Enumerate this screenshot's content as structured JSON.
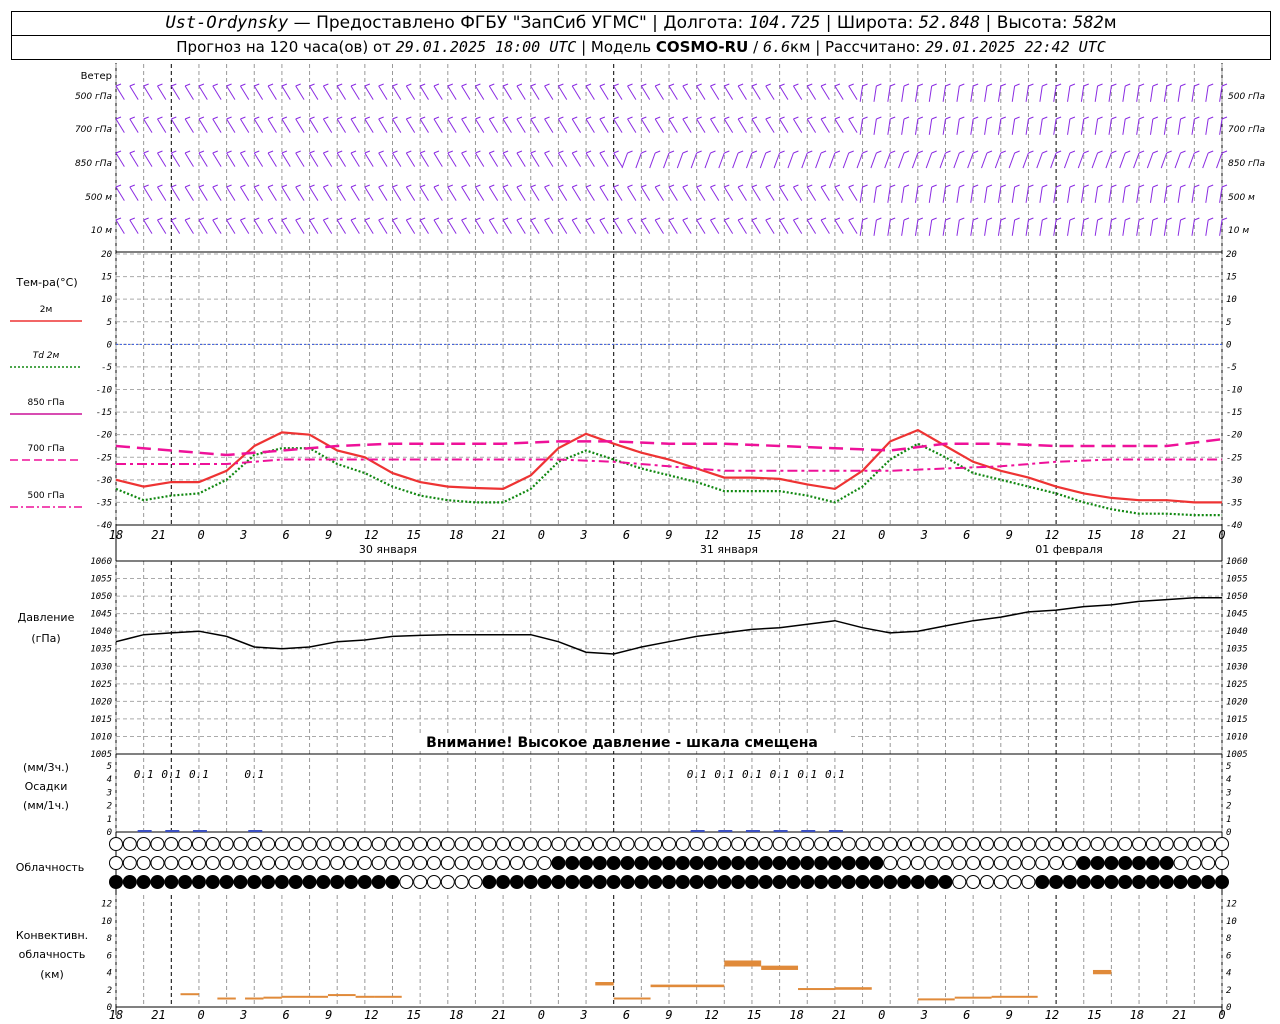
{
  "header": {
    "station": "Ust-Ordynsky",
    "provided": "— Предоставлено ФГБУ \"ЗапСиб УГМС\"",
    "lon_label": "Долгота:",
    "lon": "104.725",
    "lat_label": "Широта:",
    "lat": "52.848",
    "alt_label": "Высота:",
    "alt": "582",
    "alt_unit": "м",
    "forecast_label": "Прогноз на 120 часа(ов) от",
    "forecast_start": "29.01.2025 18:00 UTC",
    "model_label": "Модель",
    "model": "COSMO-RU",
    "model_res": "6.6",
    "model_res_unit": "км",
    "calc_label": "Рассчитано:",
    "calc_time": "29.01.2025 22:42 UTC"
  },
  "wind_panel": {
    "row_labels": [
      "500 гПа",
      "700 гПа",
      "850 гПа",
      "500 м",
      "10  м"
    ],
    "title": "Ветер",
    "color": "#8a2be2"
  },
  "temp_panel": {
    "title": "Тем-ра(°С)",
    "legend": [
      {
        "label": "2м",
        "color": "#ee3333",
        "style": "solid"
      },
      {
        "label": "Td  2м",
        "color": "#118811",
        "style": "dotted"
      },
      {
        "label": "850 гПа",
        "color": "#cc1199",
        "style": "solid"
      },
      {
        "label": "700 гПа",
        "color": "#ee1199",
        "style": "dash"
      },
      {
        "label": "500 гПа",
        "color": "#ee1199",
        "style": "dashdot"
      }
    ],
    "ticks": [
      20,
      15,
      10,
      5,
      0,
      -5,
      -10,
      -15,
      -20,
      -25,
      -30,
      -35,
      -40
    ]
  },
  "time_axis": {
    "hour_labels": [
      "18",
      "21",
      "0",
      "3",
      "6",
      "9",
      "12",
      "15",
      "18",
      "21",
      "0",
      "3",
      "6",
      "9",
      "12",
      "15",
      "18",
      "21",
      "0",
      "3",
      "6",
      "9",
      "12",
      "15",
      "18",
      "21",
      "0"
    ],
    "date_labels": [
      "30 января",
      "31 января",
      "01 февраля"
    ]
  },
  "pressure_panel": {
    "title": "Давление",
    "unit": "(гПа)",
    "ticks": [
      1060,
      1055,
      1050,
      1045,
      1040,
      1035,
      1030,
      1025,
      1020,
      1015,
      1010,
      1005
    ],
    "warning": "Внимание! Высокое давление - шкала смещена"
  },
  "precip_panel": {
    "unit_top": "(мм/3ч.)",
    "title": "Осадки",
    "unit_bottom": "(мм/1ч.)",
    "ticks": [
      5,
      4,
      3,
      2,
      1,
      0
    ],
    "labels": [
      {
        "h": 3,
        "text": "0.1"
      },
      {
        "h": 6,
        "text": "0.1"
      },
      {
        "h": 9,
        "text": "0.1"
      },
      {
        "h": 15,
        "text": "0.1"
      },
      {
        "h": 63,
        "text": "0.1"
      },
      {
        "h": 66,
        "text": "0.1"
      },
      {
        "h": 69,
        "text": "0.1"
      },
      {
        "h": 72,
        "text": "0.1"
      },
      {
        "h": 75,
        "text": "0.1"
      },
      {
        "h": 78,
        "text": "0.1"
      }
    ]
  },
  "cloud_panel": {
    "title": "Облачность"
  },
  "conv_panel": {
    "title_line1": "Конвективн.",
    "title_line2": "облачность",
    "unit": "(км)",
    "ticks": [
      12,
      10,
      8,
      6,
      4,
      2,
      0
    ],
    "color": "#e08a3a"
  },
  "chart_data": [
    {
      "type": "line",
      "title": "Тем-ра(°С)",
      "x_unit": "hours since 29.01.2025 18:00 UTC",
      "ylim": [
        -40,
        20
      ],
      "series": [
        {
          "name": "2м",
          "x": [
            0,
            3,
            6,
            9,
            12,
            15,
            18,
            21,
            24,
            27,
            30,
            33,
            36,
            39,
            42,
            45,
            48,
            51,
            54,
            57,
            60,
            63,
            66,
            69,
            72,
            75,
            78,
            81,
            84,
            87,
            90,
            93,
            96,
            99,
            102,
            105,
            108,
            111,
            114,
            117,
            120
          ],
          "values": [
            -30,
            -31.5,
            -30.5,
            -30.5,
            -28,
            -22.5,
            -19.5,
            -20,
            -23.5,
            -25,
            -28.5,
            -30.5,
            -31.5,
            -31.8,
            -32,
            -29,
            -23,
            -19.8,
            -22,
            -24,
            -25.5,
            -27.5,
            -29.5,
            -29.5,
            -29.8,
            -31,
            -32,
            -28,
            -21.5,
            -19,
            -22.5,
            -26,
            -28,
            -29.5,
            -31.5,
            -33,
            -34,
            -34.5,
            -34.5,
            -35,
            -35
          ]
        },
        {
          "name": "Td  2м",
          "x": [
            0,
            3,
            6,
            9,
            12,
            15,
            18,
            21,
            24,
            27,
            30,
            33,
            36,
            39,
            42,
            45,
            48,
            51,
            54,
            57,
            60,
            63,
            66,
            69,
            72,
            75,
            78,
            81,
            84,
            87,
            90,
            93,
            96,
            99,
            102,
            105,
            108,
            111,
            114,
            117,
            120
          ],
          "values": [
            -32,
            -34.5,
            -33.5,
            -33,
            -30,
            -24.5,
            -23,
            -23,
            -26.5,
            -28.5,
            -31.5,
            -33.5,
            -34.5,
            -35,
            -35,
            -32,
            -26,
            -23.5,
            -25.5,
            -27.5,
            -29,
            -30.5,
            -32.5,
            -32.5,
            -32.5,
            -33.5,
            -35,
            -31.5,
            -25.5,
            -22,
            -25,
            -28.5,
            -30,
            -31.5,
            -33,
            -35,
            -36.5,
            -37.5,
            -37.5,
            -37.8,
            -37.8
          ]
        },
        {
          "name": "700 гПа",
          "x": [
            0,
            6,
            12,
            18,
            24,
            30,
            36,
            42,
            48,
            54,
            60,
            66,
            72,
            78,
            84,
            90,
            96,
            102,
            108,
            114,
            120
          ],
          "values": [
            -22.5,
            -23.5,
            -24.5,
            -23.5,
            -22.5,
            -22,
            -22,
            -22,
            -21.5,
            -21.5,
            -22,
            -22,
            -22.5,
            -23,
            -23.5,
            -22,
            -22,
            -22.5,
            -22.5,
            -22.5,
            -21
          ]
        },
        {
          "name": "500 гПа",
          "x": [
            0,
            6,
            12,
            18,
            24,
            30,
            36,
            42,
            48,
            54,
            60,
            66,
            72,
            78,
            84,
            90,
            96,
            102,
            108,
            114,
            120
          ],
          "values": [
            -26.5,
            -26.5,
            -26.5,
            -25.5,
            -25.5,
            -25.5,
            -25.5,
            -25.5,
            -25.5,
            -26,
            -27,
            -28,
            -28,
            -28,
            -28,
            -27.5,
            -27,
            -26,
            -25.5,
            -25.5,
            -25.5
          ]
        }
      ]
    },
    {
      "type": "line",
      "title": "Давление",
      "ylabel": "(гПа)",
      "x_unit": "hours since 29.01.2025 18:00 UTC",
      "ylim": [
        1005,
        1060
      ],
      "series": [
        {
          "name": "Давление",
          "x": [
            0,
            3,
            6,
            9,
            12,
            15,
            18,
            21,
            24,
            27,
            30,
            33,
            36,
            39,
            42,
            45,
            48,
            51,
            54,
            57,
            60,
            63,
            66,
            69,
            72,
            75,
            78,
            81,
            84,
            87,
            90,
            93,
            96,
            99,
            102,
            105,
            108,
            111,
            114,
            117,
            120
          ],
          "values": [
            1037,
            1039,
            1039.5,
            1040,
            1038.5,
            1035.5,
            1035,
            1035.5,
            1037,
            1037.5,
            1038.5,
            1038.8,
            1039,
            1039,
            1039,
            1039,
            1037,
            1034,
            1033.5,
            1035.5,
            1037,
            1038.5,
            1039.5,
            1040.5,
            1041,
            1042,
            1043,
            1041,
            1039.5,
            1040,
            1041.5,
            1043,
            1044,
            1045.5,
            1046,
            1047,
            1047.5,
            1048.5,
            1049,
            1049.5,
            1049.5
          ]
        }
      ]
    },
    {
      "type": "bar",
      "title": "Конвективн. облачность",
      "ylabel": "(км)",
      "ylim": [
        0,
        13
      ],
      "series": [
        {
          "name": "convective",
          "segments": [
            {
              "x0": 7,
              "x1": 9,
              "base": 1.4,
              "top": 1.6
            },
            {
              "x0": 11,
              "x1": 13,
              "base": 0.9,
              "top": 1.1
            },
            {
              "x0": 14,
              "x1": 16,
              "base": 0.9,
              "top": 1.1
            },
            {
              "x0": 16,
              "x1": 18,
              "base": 1.1,
              "top": 1.2
            },
            {
              "x0": 18,
              "x1": 23,
              "base": 1.2,
              "top": 1.3
            },
            {
              "x0": 23,
              "x1": 26,
              "base": 1.3,
              "top": 1.5
            },
            {
              "x0": 26,
              "x1": 28,
              "base": 1.1,
              "top": 1.3
            },
            {
              "x0": 28,
              "x1": 31,
              "base": 1.1,
              "top": 1.3
            },
            {
              "x0": 52,
              "x1": 54,
              "base": 2.5,
              "top": 2.9
            },
            {
              "x0": 54,
              "x1": 58,
              "base": 0.9,
              "top": 1.1
            },
            {
              "x0": 58,
              "x1": 66,
              "base": 2.3,
              "top": 2.6
            },
            {
              "x0": 66,
              "x1": 70,
              "base": 4.7,
              "top": 5.4
            },
            {
              "x0": 70,
              "x1": 74,
              "base": 4.3,
              "top": 4.8
            },
            {
              "x0": 74,
              "x1": 78,
              "base": 2.0,
              "top": 2.2
            },
            {
              "x0": 78,
              "x1": 82,
              "base": 2.0,
              "top": 2.3
            },
            {
              "x0": 87,
              "x1": 91,
              "base": 0.9,
              "top": 1.0
            },
            {
              "x0": 91,
              "x1": 95,
              "base": 1.1,
              "top": 1.2
            },
            {
              "x0": 95,
              "x1": 100,
              "base": 1.2,
              "top": 1.3
            },
            {
              "x0": 106,
              "x1": 108,
              "base": 3.8,
              "top": 4.3
            }
          ]
        }
      ]
    }
  ]
}
